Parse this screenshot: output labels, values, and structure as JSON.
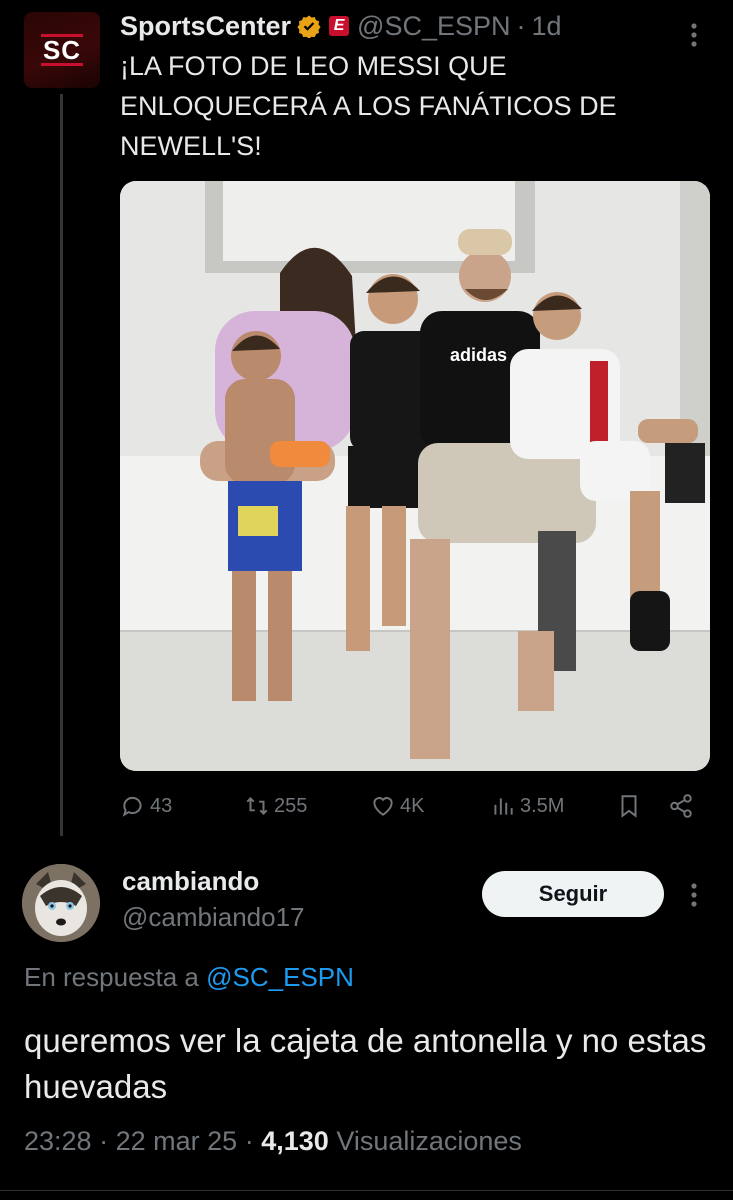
{
  "parent_tweet": {
    "display_name": "SportsCenter",
    "badge_letter": "E",
    "handle": "@SC_ESPN",
    "separator": "·",
    "age": "1d",
    "avatar_label": "SC",
    "text": "¡LA FOTO DE LEO MESSI QUE ENLOQUECERÁ A LOS FANÁTICOS DE NEWELL'S!",
    "actions": {
      "replies": "43",
      "retweets": "255",
      "likes": "4K",
      "views": "3.5M"
    }
  },
  "reply": {
    "display_name": "cambiando",
    "handle": "@cambiando17",
    "follow_label": "Seguir",
    "reply_prefix": "En respuesta a",
    "reply_mention": "@SC_ESPN",
    "text": "queremos ver la cajeta de antonella y no estas huevadas",
    "time": "23:28",
    "date": "22 mar 25",
    "sep": "·",
    "views_count": "4,130",
    "views_label": "Visualizaciones"
  },
  "colors": {
    "background": "#000000",
    "text": "#e7e9ea",
    "muted": "#71767b",
    "link": "#1d9bf0",
    "verified": "#e8a317",
    "espn_red": "#c8102e"
  }
}
